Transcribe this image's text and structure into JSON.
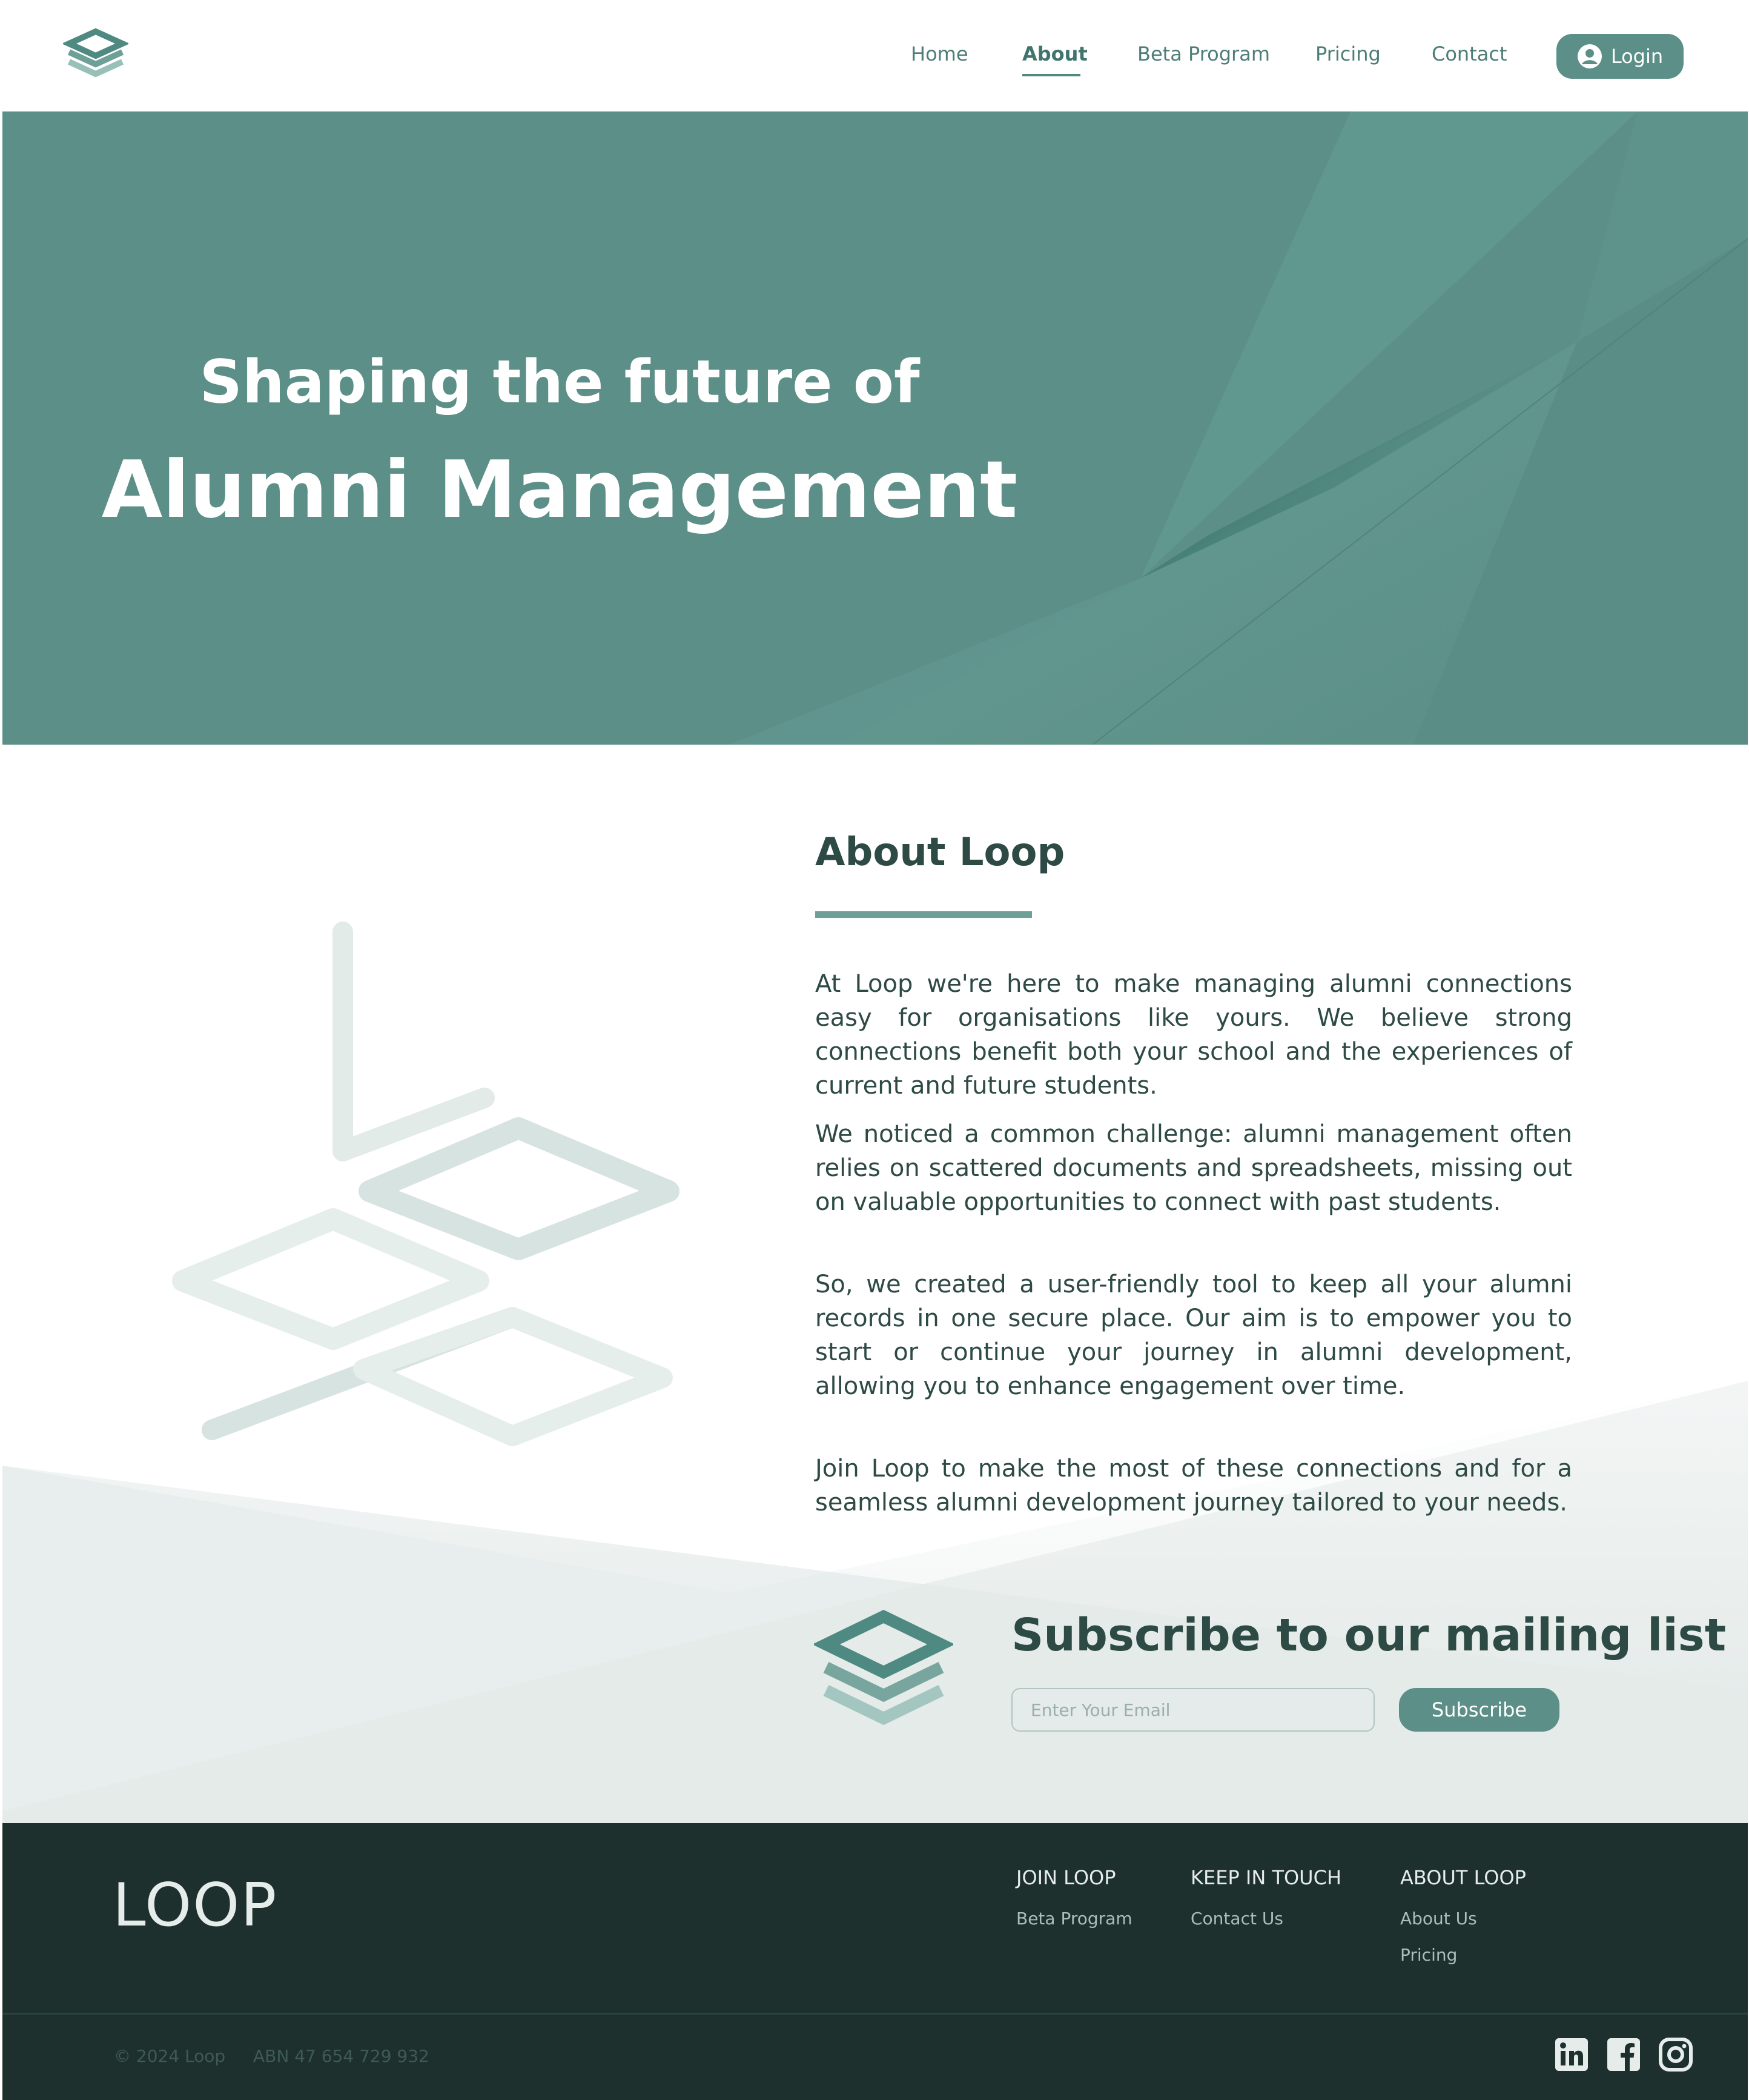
{
  "nav": {
    "items": [
      {
        "label": "Home",
        "active": false
      },
      {
        "label": "About",
        "active": true
      },
      {
        "label": "Beta Program",
        "active": false
      },
      {
        "label": "Pricing",
        "active": false
      },
      {
        "label": "Contact",
        "active": false
      }
    ],
    "login_label": "Login",
    "icons": {
      "logo": "loop-logo-icon",
      "login": "user-circle-icon"
    }
  },
  "hero": {
    "subtitle": "Shaping the future of",
    "title": "Alumni Management"
  },
  "about": {
    "heading": "About Loop",
    "paragraphs": [
      "At Loop we're here to make managing alumni connections easy for organisations like yours. We believe strong connections benefit both your school and the experiences of current and future students.",
      "We noticed a common challenge: alumni management often relies on scattered documents and spreadsheets, missing out on valuable opportunities to connect with past students.",
      "So, we created a user-friendly tool to keep all your alumni records in one secure place. Our aim is to empower you to start or continue your journey in alumni development, allowing you to enhance engagement over time.",
      "Join Loop to make the most of these connections and for a seamless alumni development journey tailored to your needs."
    ]
  },
  "subscribe": {
    "heading": "Subscribe to our mailing list",
    "email_placeholder": "Enter Your Email",
    "email_value": "",
    "button_label": "Subscribe"
  },
  "footer": {
    "brand": "LOOP",
    "columns": [
      {
        "title": "JOIN LOOP",
        "links": [
          "Beta Program"
        ]
      },
      {
        "title": "KEEP IN TOUCH",
        "links": [
          "Contact Us"
        ]
      },
      {
        "title": "ABOUT LOOP",
        "links": [
          "About Us",
          "Pricing"
        ]
      }
    ],
    "copyright": "© 2024 Loop",
    "abn": "ABN 47 654 729 932",
    "social_icons": [
      "linkedin-icon",
      "facebook-icon",
      "instagram-icon"
    ]
  },
  "colors": {
    "primary": "#5b8f87",
    "primary_dark": "#3f756d",
    "text": "#2e4a45",
    "footer_bg": "#1d302d",
    "footer_text": "#e6ecea"
  }
}
